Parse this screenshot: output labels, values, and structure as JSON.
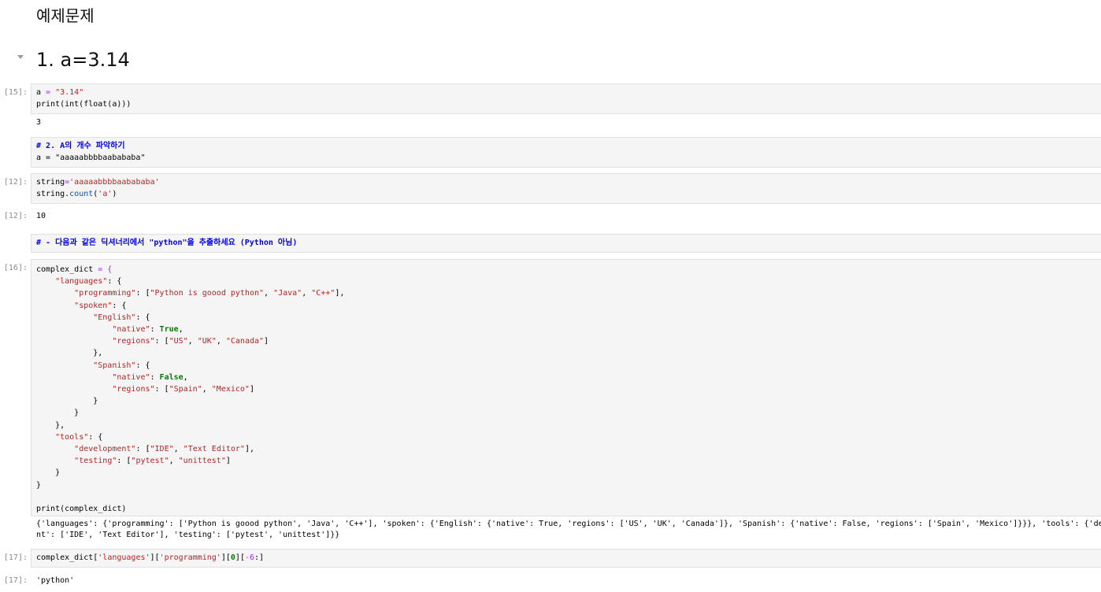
{
  "markdown": {
    "title": "예제문제",
    "heading1": "1. a=3.14"
  },
  "cells": [
    {
      "prompt": "[15]:",
      "out_prompt": "",
      "output": "3"
    },
    {
      "prompt": "",
      "output": ""
    },
    {
      "prompt": "[12]:",
      "out_prompt": "[12]:",
      "output": "10"
    },
    {
      "prompt": "",
      "output": ""
    },
    {
      "prompt": "[16]:",
      "out_prompt": "",
      "output": "{'languages': {'programming': ['Python is goood python', 'Java', 'C++'], 'spoken': {'English': {'native': True, 'regions': ['US', 'UK', 'Canada']}, 'Spanish': {'native': False, 'regions': ['Spain', 'Mexico']}}}, 'tools': {'deve\nnt': ['IDE', 'Text Editor'], 'testing': ['pytest', 'unittest']}}"
    },
    {
      "prompt": "[17]:",
      "out_prompt": "[17]:",
      "output": "'python'"
    }
  ],
  "code_tokens": {
    "c1": [
      "a",
      " = ",
      "\"3.14\"",
      "print(int(float(a)))"
    ],
    "c2": [
      "# 2. A의 개수 파악하기",
      "a = \"aaaaabbbbaabababa\""
    ],
    "c3": [
      "string",
      "=",
      "'aaaaabbbbaabababa'",
      "string.",
      "count",
      "(",
      "'a'",
      ")"
    ],
    "c4": [
      "# - 다음과 같은 딕셔너리에서 \"python\"을 추출하세요 (Python 아님)"
    ],
    "c5": [
      "complex_dict",
      " = {",
      "    ",
      "\"languages\"",
      ": {",
      "        ",
      "\"programming\"",
      ": [",
      "\"Python is goood python\"",
      ", ",
      "\"Java\"",
      ", ",
      "\"C++\"",
      "],",
      "        ",
      "\"spoken\"",
      ": {",
      "            ",
      "\"English\"",
      ": {",
      "                ",
      "\"native\"",
      ": ",
      "True",
      ",",
      "                ",
      "\"regions\"",
      ": [",
      "\"US\"",
      ", ",
      "\"UK\"",
      ", ",
      "\"Canada\"",
      "]",
      "            },",
      "            ",
      "\"Spanish\"",
      ": {",
      "                ",
      "\"native\"",
      ": ",
      "False",
      ",",
      "                ",
      "\"regions\"",
      ": [",
      "\"Spain\"",
      ", ",
      "\"Mexico\"",
      "]",
      "            }",
      "        }",
      "    },",
      "    ",
      "\"tools\"",
      ": {",
      "        ",
      "\"development\"",
      ": [",
      "\"IDE\"",
      ", ",
      "\"Text Editor\"",
      "],",
      "        ",
      "\"testing\"",
      ": [",
      "\"pytest\"",
      ", ",
      "\"unittest\"",
      "]",
      "    }",
      "}",
      "print(complex_dict)"
    ],
    "c6": [
      "complex_dict[",
      "'languages'",
      "][",
      "'programming'",
      "][",
      "0",
      "][",
      "-6",
      ":]"
    ]
  },
  "colors": {
    "string": "#ba2121",
    "operator": "#aa22ff",
    "keyword": "#008000",
    "comment": "#0000ee",
    "cell_bg": "#f5f5f5",
    "prompt": "#8a8a8a"
  }
}
